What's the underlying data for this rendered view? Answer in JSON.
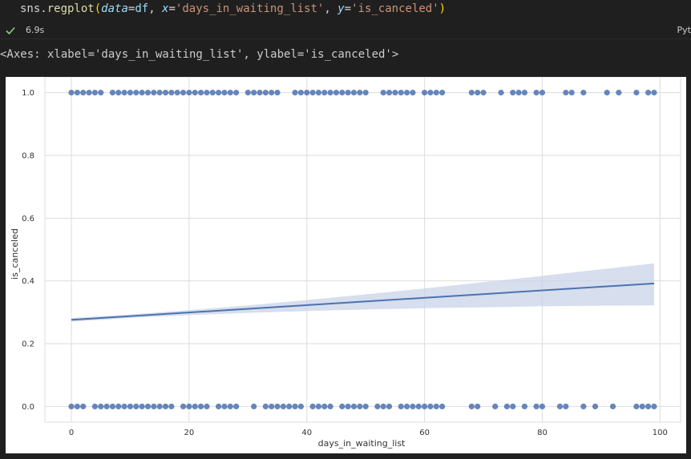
{
  "cell": {
    "code": {
      "fn_prefix": "sns.",
      "fn_name": "regplot",
      "open_paren": "(",
      "arg1_kw": "data",
      "arg1_eq": "=",
      "arg1_val": "df",
      "sep1": ", ",
      "arg2_kw": "x",
      "arg2_eq": "=",
      "arg2_val": "'days_in_waiting_list'",
      "sep2": ", ",
      "arg3_kw": "y",
      "arg3_eq": "=",
      "arg3_val": "'is_canceled'",
      "close_paren": ")"
    },
    "status": {
      "icon": "check-icon",
      "exec_time": "6.9s",
      "language": "Pyt"
    },
    "output_text": "<Axes: xlabel='days_in_waiting_list', ylabel='is_canceled'>"
  },
  "colors": {
    "point": "#4c72b0",
    "line": "#4c72b0",
    "ci_band": "#c9d3e8",
    "grid": "#dddddd"
  },
  "chart_data": {
    "type": "scatter",
    "xlabel": "days_in_waiting_list",
    "ylabel": "is_canceled",
    "xlim": [
      -4.5,
      103.5
    ],
    "ylim": [
      -0.05,
      1.05
    ],
    "xticks": [
      0,
      20,
      40,
      60,
      80,
      100
    ],
    "yticks": [
      0.0,
      0.2,
      0.4,
      0.6,
      0.8,
      1.0
    ],
    "xtick_labels": [
      "0",
      "20",
      "40",
      "60",
      "80",
      "100"
    ],
    "ytick_labels": [
      "0.0",
      "0.2",
      "0.4",
      "0.6",
      "0.8",
      "1.0"
    ],
    "grid": true,
    "points_y1": [
      0,
      1,
      2,
      3,
      4,
      5,
      7,
      8,
      9,
      10,
      11,
      12,
      13,
      14,
      15,
      16,
      17,
      18,
      19,
      20,
      21,
      22,
      23,
      24,
      25,
      26,
      27,
      28,
      30,
      31,
      32,
      33,
      34,
      35,
      38,
      39,
      40,
      41,
      42,
      43,
      44,
      45,
      46,
      47,
      48,
      49,
      50,
      53,
      54,
      55,
      56,
      57,
      58,
      60,
      61,
      62,
      63,
      68,
      69,
      70,
      73,
      75,
      76,
      77,
      79,
      80,
      84,
      85,
      87,
      91,
      93,
      96,
      98,
      99
    ],
    "points_y0": [
      0,
      1,
      2,
      4,
      5,
      6,
      7,
      8,
      9,
      10,
      11,
      12,
      13,
      14,
      15,
      16,
      17,
      19,
      20,
      21,
      22,
      23,
      25,
      26,
      27,
      28,
      31,
      33,
      34,
      35,
      36,
      37,
      38,
      39,
      41,
      42,
      43,
      44,
      46,
      47,
      48,
      49,
      50,
      52,
      53,
      54,
      56,
      57,
      58,
      59,
      60,
      61,
      62,
      63,
      68,
      69,
      72,
      74,
      75,
      77,
      79,
      80,
      83,
      84,
      87,
      89,
      92,
      96,
      97,
      98,
      99
    ],
    "regression": {
      "x": [
        0,
        99
      ],
      "y": [
        0.276,
        0.392
      ]
    },
    "ci": {
      "x": [
        0,
        10,
        20,
        30,
        40,
        50,
        60,
        70,
        80,
        90,
        99
      ],
      "lower": [
        0.27,
        0.282,
        0.291,
        0.298,
        0.304,
        0.309,
        0.313,
        0.316,
        0.319,
        0.321,
        0.322
      ],
      "upper": [
        0.282,
        0.293,
        0.307,
        0.322,
        0.339,
        0.357,
        0.376,
        0.396,
        0.416,
        0.437,
        0.456
      ]
    }
  }
}
